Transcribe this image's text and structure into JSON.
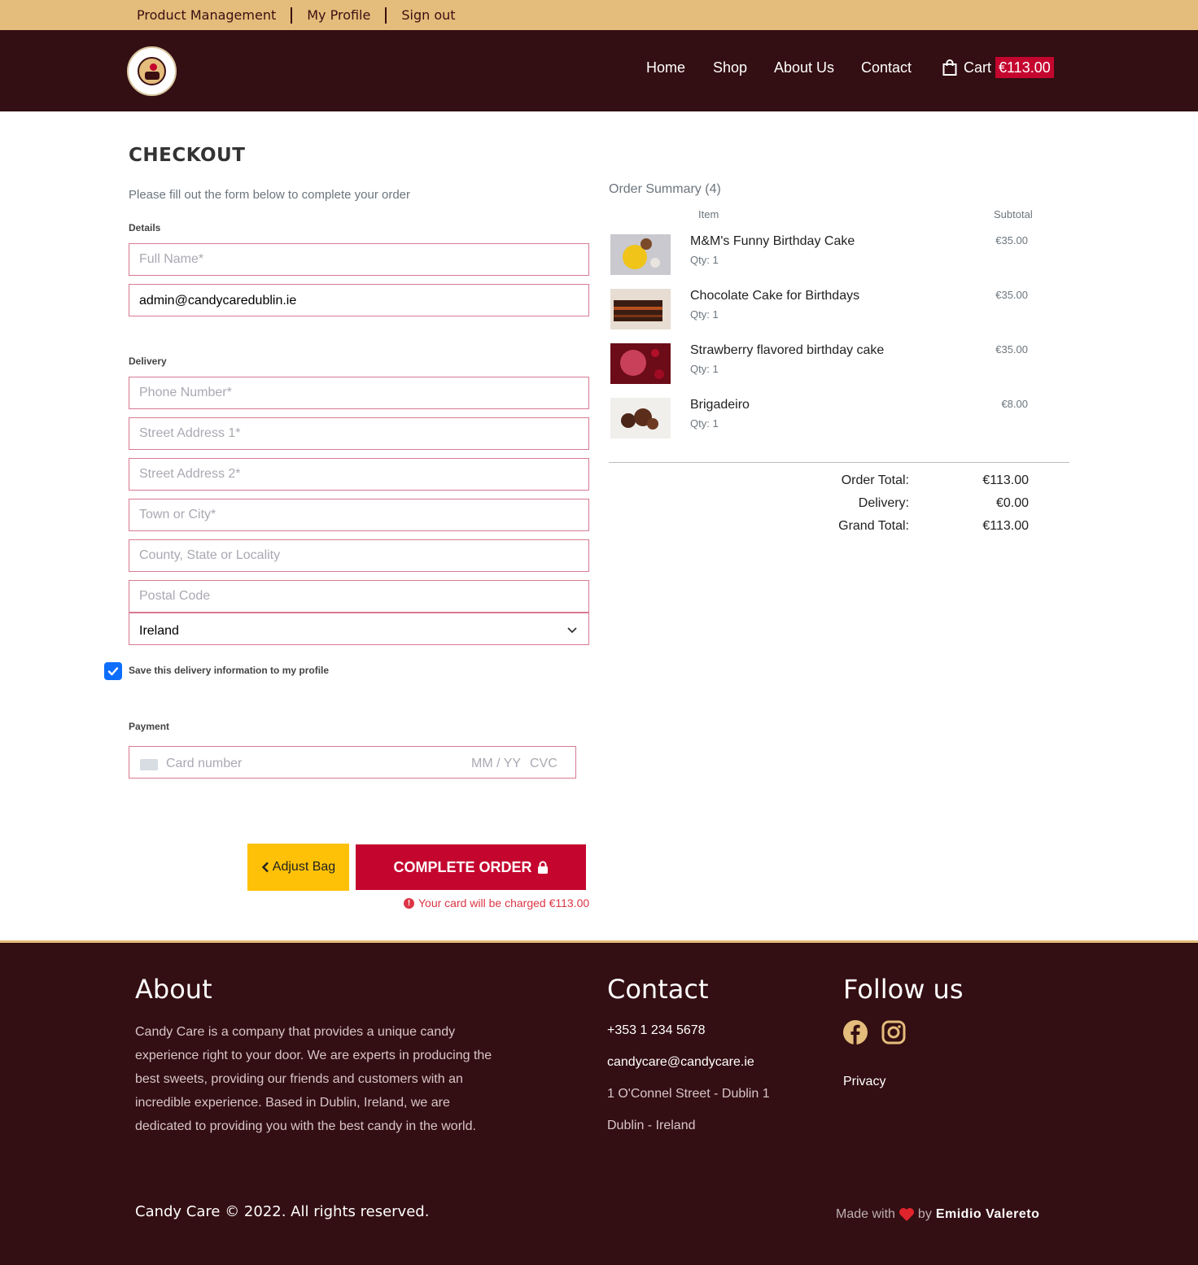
{
  "topbar": {
    "links": [
      "Product Management",
      "My Profile",
      "Sign out"
    ]
  },
  "header": {
    "nav": {
      "home": "Home",
      "shop": "Shop",
      "about": "About Us",
      "contact": "Contact",
      "cart": "Cart"
    },
    "cart_total": "€113.00"
  },
  "checkout": {
    "title": "CHECKOUT",
    "lead": "Please fill out the form below to complete your order",
    "details_label": "Details",
    "full_name_placeholder": "Full Name*",
    "email_value": "admin@candycaredublin.ie",
    "delivery_label": "Delivery",
    "phone_placeholder": "Phone Number*",
    "street1_placeholder": "Street Address 1*",
    "street2_placeholder": "Street Address 2*",
    "town_placeholder": "Town or City*",
    "county_placeholder": "County, State or Locality",
    "postcode_placeholder": "Postal Code",
    "country_value": "Ireland",
    "save_info_label": "Save this delivery information to my profile",
    "payment_label": "Payment",
    "card_number_placeholder": "Card number",
    "card_exp_placeholder": "MM / YY",
    "card_cvc_placeholder": "CVC",
    "adjust_bag_label": "Adjust Bag",
    "complete_order_label": "COMPLETE ORDER",
    "charge_note": "Your card will be charged €113.00"
  },
  "summary": {
    "title": "Order Summary (4)",
    "col_item": "Item",
    "col_subtotal": "Subtotal",
    "items": [
      {
        "name": "M&M's Funny Birthday Cake",
        "qty": "Qty: 1",
        "price": "€35.00"
      },
      {
        "name": "Chocolate Cake for Birthdays",
        "qty": "Qty: 1",
        "price": "€35.00"
      },
      {
        "name": "Strawberry flavored birthday cake",
        "qty": "Qty: 1",
        "price": "€35.00"
      },
      {
        "name": "Brigadeiro",
        "qty": "Qty: 1",
        "price": "€8.00"
      }
    ],
    "order_total_label": "Order Total:",
    "order_total": "€113.00",
    "delivery_label": "Delivery:",
    "delivery": "€0.00",
    "grand_total_label": "Grand Total:",
    "grand_total": "€113.00"
  },
  "footer": {
    "about_title": "About",
    "about_text": "Candy Care is a company that provides a unique candy experience right to your door. We are experts in producing the best sweets, providing our friends and customers with an incredible experience. Based in Dublin, Ireland, we are dedicated to providing you with the best candy in the world.",
    "contact_title": "Contact",
    "phone": "+353 1 234 5678",
    "email": "candycare@candycare.ie",
    "address1": "1 O'Connel Street - Dublin 1",
    "address2": "Dublin - Ireland",
    "follow_title": "Follow us",
    "privacy": "Privacy",
    "copyright": "Candy Care © 2022. All rights reserved.",
    "made_with": "Made with",
    "by": "by",
    "author": "Emidio Valereto"
  },
  "colors": {
    "brand_dark": "#330e12",
    "brand_gold": "#e4bc7b",
    "accent_red": "#c4062f",
    "button_yellow": "#ffc107"
  },
  "icons": [
    "logo",
    "shopping-bag-icon",
    "chevron-down-icon",
    "checkmark-icon",
    "credit-card-icon",
    "chevron-left-icon",
    "lock-icon",
    "exclamation-icon",
    "facebook-icon",
    "instagram-icon",
    "heart-icon"
  ]
}
